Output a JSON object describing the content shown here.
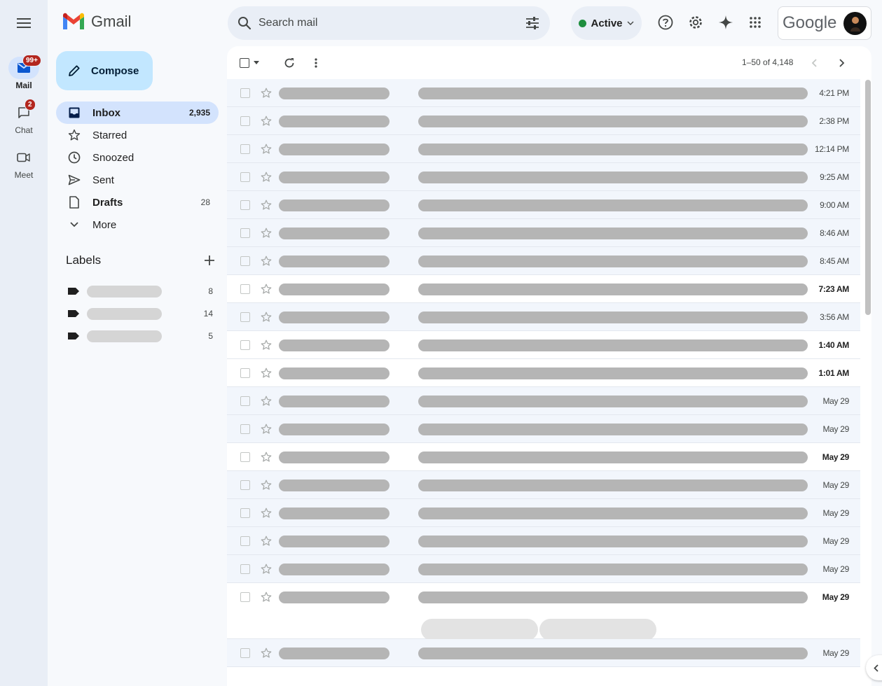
{
  "app": {
    "name": "Gmail",
    "account_brand": "Google"
  },
  "rail": {
    "items": [
      {
        "label": "Mail",
        "icon": "mail-icon",
        "badge": "99+"
      },
      {
        "label": "Chat",
        "icon": "chat-icon",
        "badge": "2"
      },
      {
        "label": "Meet",
        "icon": "video-icon",
        "badge": ""
      }
    ]
  },
  "search": {
    "placeholder": "Search mail"
  },
  "status": {
    "label": "Active",
    "color": "#1e8e3e"
  },
  "compose": {
    "label": "Compose"
  },
  "nav": {
    "items": [
      {
        "label": "Inbox",
        "count": "2,935",
        "icon": "inbox-icon"
      },
      {
        "label": "Starred",
        "count": "",
        "icon": "star-icon"
      },
      {
        "label": "Snoozed",
        "count": "",
        "icon": "clock-icon"
      },
      {
        "label": "Sent",
        "count": "",
        "icon": "send-icon"
      },
      {
        "label": "Drafts",
        "count": "28",
        "icon": "draft-icon"
      },
      {
        "label": "More",
        "count": "",
        "icon": "chevron-down-icon"
      }
    ]
  },
  "labels": {
    "title": "Labels",
    "items": [
      {
        "count": "8"
      },
      {
        "count": "14"
      },
      {
        "count": "5"
      }
    ]
  },
  "pager": {
    "text": "1–50 of 4,148"
  },
  "emails": [
    {
      "time": "4:21 PM",
      "unread": false
    },
    {
      "time": "2:38 PM",
      "unread": false
    },
    {
      "time": "12:14 PM",
      "unread": false
    },
    {
      "time": "9:25 AM",
      "unread": false
    },
    {
      "time": "9:00 AM",
      "unread": false
    },
    {
      "time": "8:46 AM",
      "unread": false
    },
    {
      "time": "8:45 AM",
      "unread": false
    },
    {
      "time": "7:23 AM",
      "unread": true
    },
    {
      "time": "3:56 AM",
      "unread": false
    },
    {
      "time": "1:40 AM",
      "unread": true
    },
    {
      "time": "1:01 AM",
      "unread": true
    },
    {
      "time": "May 29",
      "unread": false
    },
    {
      "time": "May 29",
      "unread": false
    },
    {
      "time": "May 29",
      "unread": true
    },
    {
      "time": "May 29",
      "unread": false
    },
    {
      "time": "May 29",
      "unread": false
    },
    {
      "time": "May 29",
      "unread": false
    },
    {
      "time": "May 29",
      "unread": false
    },
    {
      "time": "May 29",
      "unread": true
    },
    {
      "time": "May 29",
      "unread": false
    }
  ]
}
